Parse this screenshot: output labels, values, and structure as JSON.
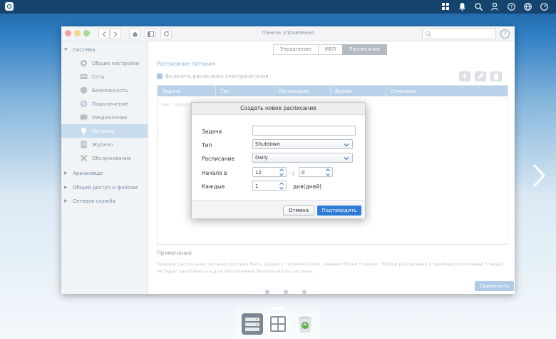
{
  "window": {
    "title": "Панель управления",
    "tabs": [
      {
        "label": "Управление",
        "active": false
      },
      {
        "label": "ИБП",
        "active": false
      },
      {
        "label": "Расписание",
        "active": true
      }
    ]
  },
  "sidebar": {
    "system_label": "Система",
    "items": [
      {
        "label": "Общие настройки",
        "icon": "gear-icon"
      },
      {
        "label": "Сеть",
        "icon": "network-icon"
      },
      {
        "label": "Безопасность",
        "icon": "shield-icon"
      },
      {
        "label": "Подключение",
        "icon": "connection-icon"
      },
      {
        "label": "Уведомление",
        "icon": "notification-icon"
      },
      {
        "label": "Питание",
        "icon": "lightbulb-icon",
        "active": true
      },
      {
        "label": "Журнал",
        "icon": "log-icon"
      },
      {
        "label": "Обслуживание",
        "icon": "tools-icon"
      }
    ],
    "categories": [
      "Хранилище",
      "Общий доступ к файлам",
      "Сетевая служба"
    ]
  },
  "content": {
    "title": "Расписание питания",
    "enable_checkbox_label": "Включить расписание электропитания",
    "columns": [
      "Задача",
      "Тип",
      "Расписание",
      "Время",
      "Описание"
    ],
    "empty_text": "Нет записи",
    "note_title": "Примечание",
    "note_text": "Каждое расписание питания должно быть задано с промежутком, равным более 5 минут. Любое расписание с промежутком менее 5 минут не будет выполняться для обеспечения безопасности системы.",
    "apply_label": "Применить"
  },
  "dialog": {
    "title": "Создать новое расписание",
    "task_label": "Задача",
    "task_value": "",
    "type_label": "Тип",
    "type_value": "Shutdown",
    "schedule_label": "Расписание",
    "schedule_value": "Daily",
    "start_label": "Начало в",
    "start_hour": "12",
    "time_sep": ":",
    "start_minute": "0",
    "every_label": "Каждые",
    "every_value": "1",
    "every_unit": "дня(дней)",
    "cancel_label": "Отмена",
    "confirm_label": "Подтвердить"
  },
  "colors": {
    "accent": "#2d7bd6",
    "topbar": "#15456e",
    "sidebar_active": "#c9dcee"
  }
}
